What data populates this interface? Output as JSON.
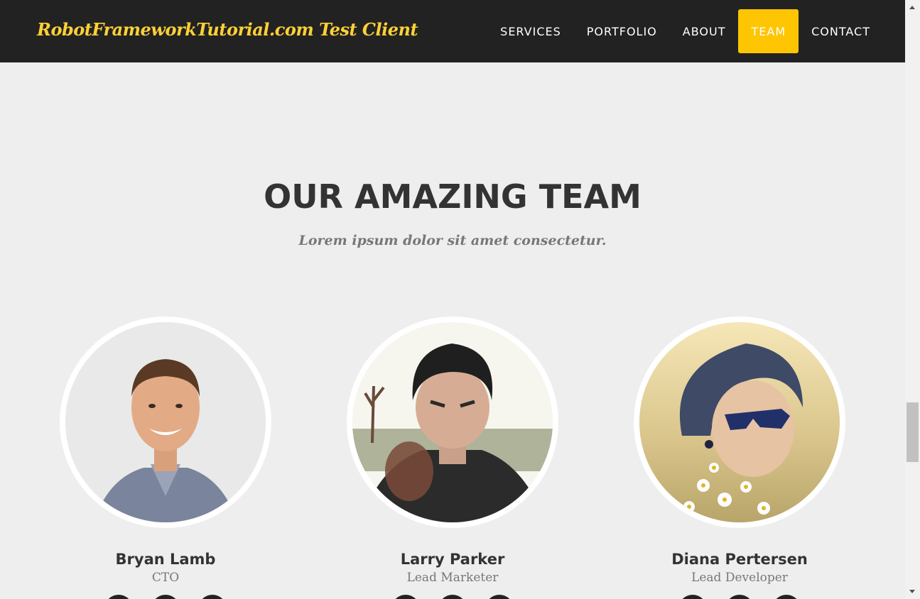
{
  "navbar": {
    "brand": "RobotFrameworkTutorial.com Test Client",
    "links": [
      {
        "label": "SERVICES",
        "active": false
      },
      {
        "label": "PORTFOLIO",
        "active": false
      },
      {
        "label": "ABOUT",
        "active": false
      },
      {
        "label": "TEAM",
        "active": true
      },
      {
        "label": "CONTACT",
        "active": false
      }
    ]
  },
  "team": {
    "heading": "OUR AMAZING TEAM",
    "subheading": "Lorem ipsum dolor sit amet consectetur.",
    "members": [
      {
        "name": "Bryan Lamb",
        "role": "CTO",
        "photo": "man-smiling-portrait"
      },
      {
        "name": "Larry Parker",
        "role": "Lead Marketer",
        "photo": "man-pointing-portrait"
      },
      {
        "name": "Diana Pertersen",
        "role": "Lead Developer",
        "photo": "woman-sunglasses-portrait"
      }
    ]
  },
  "colors": {
    "navbar_bg": "#222222",
    "brand": "#fed136",
    "active_link_bg": "#fec503",
    "page_bg": "#eeeeee",
    "heading": "#333333",
    "muted": "#777777"
  }
}
